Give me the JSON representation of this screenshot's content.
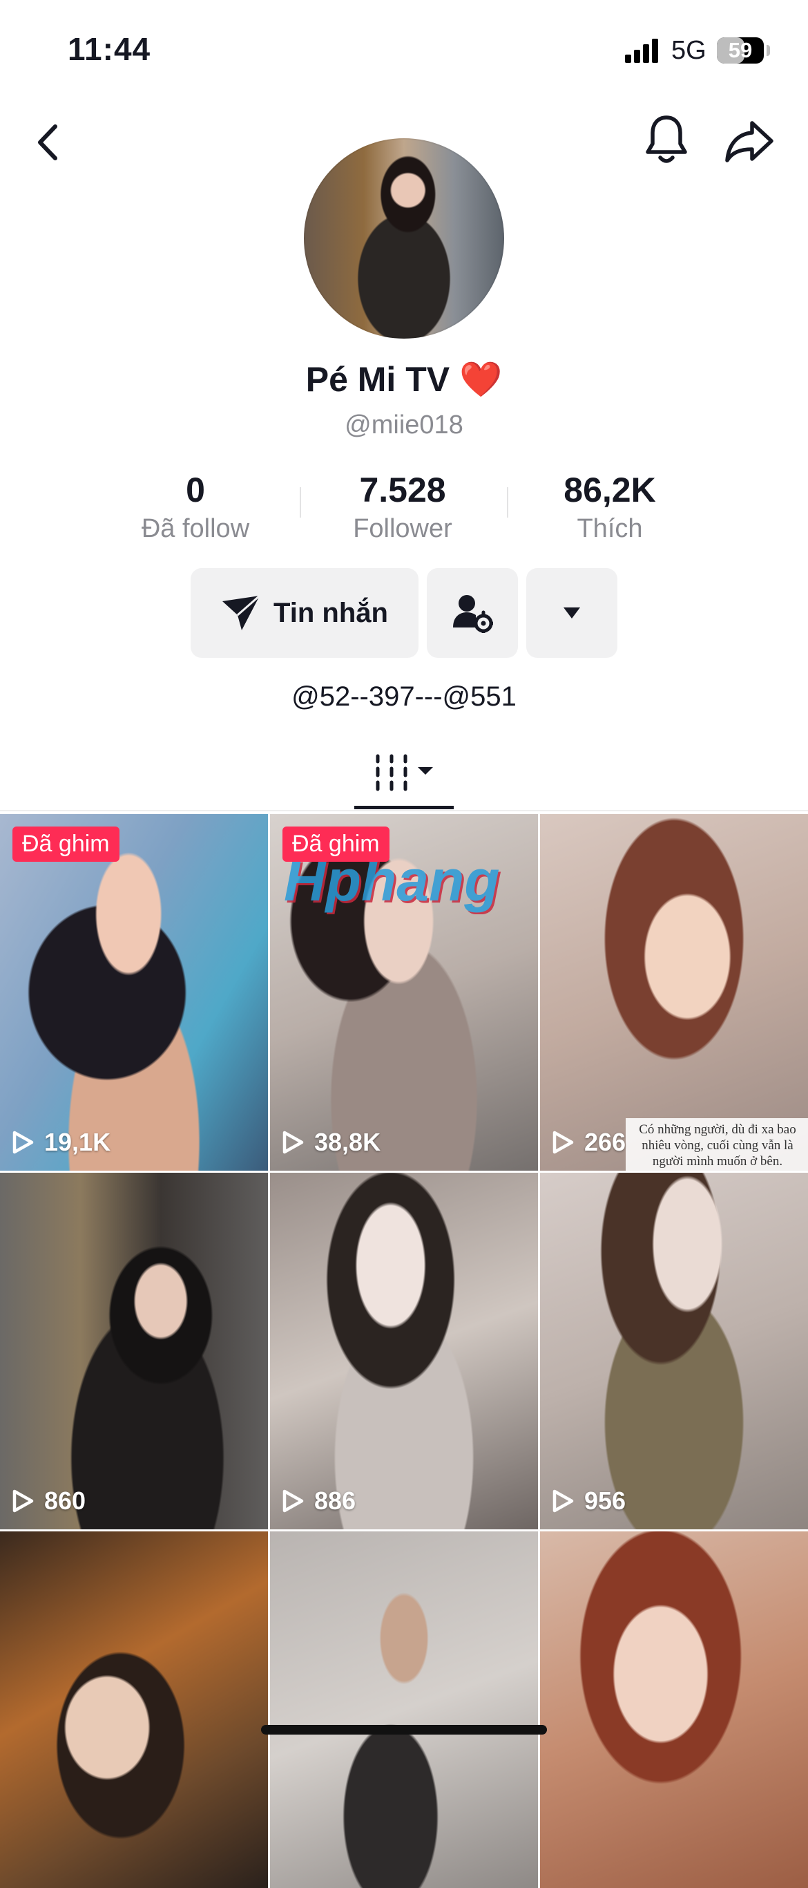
{
  "status_bar": {
    "time": "11:44",
    "network": "5G",
    "battery": "59",
    "battery_level": 0.59
  },
  "header": {
    "back_icon": "chevron-left-icon",
    "bell_icon": "bell-icon",
    "share_icon": "share-arrow-icon"
  },
  "profile": {
    "display_name": "Pé Mi TV ❤️",
    "username": "@miie018",
    "bio": "@52--397---@551"
  },
  "stats": [
    {
      "value": "0",
      "label": "Đã follow"
    },
    {
      "value": "7.528",
      "label": "Follower"
    },
    {
      "value": "86,2K",
      "label": "Thích"
    }
  ],
  "actions": {
    "message_label": "Tin nhắn",
    "message_icon": "paper-plane-icon",
    "manage_icon": "user-settings-icon",
    "dropdown_icon": "caret-down-icon"
  },
  "tabs": {
    "videos_icon": "grid-bars-icon"
  },
  "videos": [
    {
      "views": "19,1K",
      "pinned_label": "Đã ghim"
    },
    {
      "views": "38,8K",
      "pinned_label": "Đã ghim",
      "watermark": "Hphang"
    },
    {
      "views": "266",
      "caption": "Có những người, dù đi xa bao nhiêu vòng, cuối cùng vẫn là người mình muốn ở bên."
    },
    {
      "views": "860"
    },
    {
      "views": "886"
    },
    {
      "views": "956"
    },
    {
      "views": ""
    },
    {
      "views": ""
    },
    {
      "views": ""
    }
  ],
  "colors": {
    "accent": "#fe2c55",
    "text_primary": "#161823",
    "text_secondary": "#8a8b91",
    "button_bg": "#f1f1f2"
  }
}
